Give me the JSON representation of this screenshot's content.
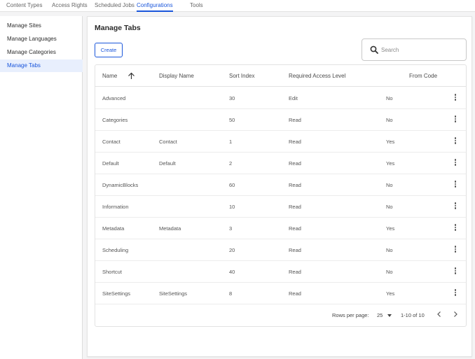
{
  "top_tabs": [
    {
      "label": "Content Types",
      "active": false
    },
    {
      "label": "Access Rights",
      "active": false
    },
    {
      "label": "Scheduled Jobs",
      "active": false
    },
    {
      "label": "Configurations",
      "active": true
    },
    {
      "label": "Tools",
      "active": false
    }
  ],
  "sidebar": {
    "items": [
      {
        "label": "Manage Sites"
      },
      {
        "label": "Manage Languages"
      },
      {
        "label": "Manage Categories"
      },
      {
        "label": "Manage Tabs",
        "active": true
      }
    ]
  },
  "main": {
    "title": "Manage Tabs",
    "create_label": "Create",
    "search": {
      "placeholder": "Search",
      "value": ""
    }
  },
  "table": {
    "columns": [
      "Name",
      "Display Name",
      "Sort Index",
      "Required Access Level",
      "From Code"
    ],
    "sort": {
      "column": "Name",
      "direction": "ascending"
    },
    "rows": [
      {
        "name": "Advanced",
        "display": "",
        "sort": "30",
        "access": "Edit",
        "from_code": "No"
      },
      {
        "name": "Categories",
        "display": "",
        "sort": "50",
        "access": "Read",
        "from_code": "No"
      },
      {
        "name": "Contact",
        "display": "Contact",
        "sort": "1",
        "access": "Read",
        "from_code": "Yes"
      },
      {
        "name": "Default",
        "display": "Default",
        "sort": "2",
        "access": "Read",
        "from_code": "Yes"
      },
      {
        "name": "DynamicBlocks",
        "display": "",
        "sort": "60",
        "access": "Read",
        "from_code": "No"
      },
      {
        "name": "Information",
        "display": "",
        "sort": "10",
        "access": "Read",
        "from_code": "No"
      },
      {
        "name": "Metadata",
        "display": "Metadata",
        "sort": "3",
        "access": "Read",
        "from_code": "Yes"
      },
      {
        "name": "Scheduling",
        "display": "",
        "sort": "20",
        "access": "Read",
        "from_code": "No"
      },
      {
        "name": "Shortcut",
        "display": "",
        "sort": "40",
        "access": "Read",
        "from_code": "No"
      },
      {
        "name": "SiteSettings",
        "display": "SiteSettings",
        "sort": "8",
        "access": "Read",
        "from_code": "Yes"
      }
    ]
  },
  "pagination": {
    "rows_per_page_label": "Rows per page:",
    "rows_per_page": "25",
    "range": "1-10 of 10"
  },
  "icons": {
    "search": "search-icon",
    "sort": "arrow-up-icon",
    "row_menu": "more-vertical-icon",
    "dropdown": "caret-down-icon",
    "prev": "chevron-left-icon",
    "next": "chevron-right-icon"
  },
  "colors": {
    "accent": "#1a56db",
    "active_bg": "#e8effd",
    "page_bg": "#f4f4f5"
  }
}
